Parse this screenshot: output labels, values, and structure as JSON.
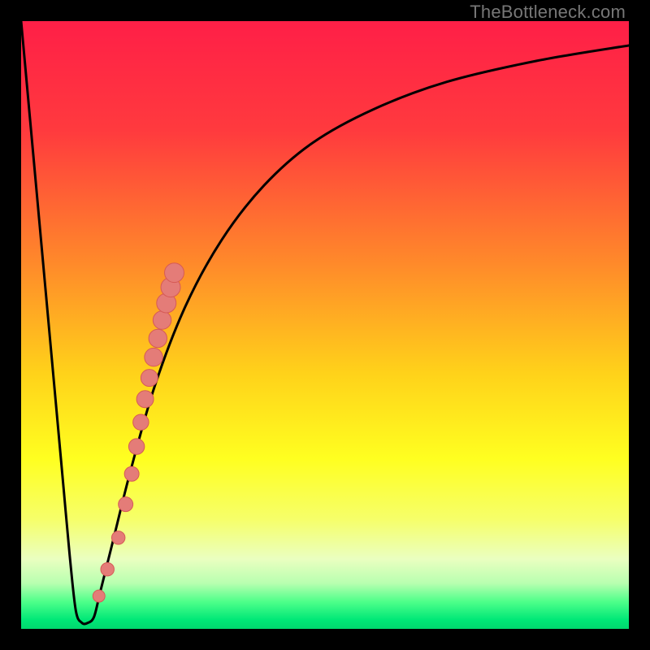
{
  "watermark": "TheBottleneck.com",
  "colors": {
    "border": "#000000",
    "curve": "#000000",
    "marker_fill": "#e47c78",
    "marker_stroke": "#d65a56",
    "gradient_stops": [
      {
        "offset": 0.0,
        "color": "#ff1f47"
      },
      {
        "offset": 0.18,
        "color": "#ff3a3e"
      },
      {
        "offset": 0.4,
        "color": "#ff8a2a"
      },
      {
        "offset": 0.58,
        "color": "#ffd21a"
      },
      {
        "offset": 0.72,
        "color": "#ffff20"
      },
      {
        "offset": 0.82,
        "color": "#f6ff6a"
      },
      {
        "offset": 0.885,
        "color": "#eaffc0"
      },
      {
        "offset": 0.925,
        "color": "#b8ffb0"
      },
      {
        "offset": 0.955,
        "color": "#4fff8a"
      },
      {
        "offset": 0.985,
        "color": "#00e877"
      },
      {
        "offset": 1.0,
        "color": "#00d86e"
      }
    ]
  },
  "chart_data": {
    "type": "line",
    "title": "",
    "xlabel": "",
    "ylabel": "",
    "xlim": [
      0,
      100
    ],
    "ylim": [
      0,
      100
    ],
    "series": [
      {
        "name": "bottleneck-curve",
        "x": [
          0,
          1,
          2,
          3,
          4,
          5,
          6,
          7,
          8,
          9,
          10,
          11,
          12,
          13,
          15,
          18,
          22,
          27,
          33,
          40,
          48,
          58,
          70,
          85,
          100
        ],
        "y": [
          100,
          89,
          78,
          67,
          56,
          45,
          34,
          23,
          12,
          3,
          1,
          1,
          2,
          6,
          14,
          26,
          40,
          53,
          64,
          73,
          80,
          85.5,
          90,
          93.5,
          96
        ]
      }
    ],
    "markers": {
      "name": "highlighted-points",
      "x_norm": [
        0.128,
        0.142,
        0.16,
        0.172,
        0.182,
        0.19,
        0.197,
        0.204,
        0.211,
        0.218,
        0.225,
        0.232,
        0.239,
        0.246,
        0.252
      ],
      "y_norm": [
        0.054,
        0.098,
        0.15,
        0.205,
        0.255,
        0.3,
        0.34,
        0.378,
        0.413,
        0.447,
        0.478,
        0.508,
        0.536,
        0.562,
        0.586
      ],
      "r_norm": [
        0.01,
        0.011,
        0.011,
        0.012,
        0.012,
        0.013,
        0.013,
        0.014,
        0.014,
        0.015,
        0.015,
        0.015,
        0.016,
        0.016,
        0.016
      ]
    }
  }
}
